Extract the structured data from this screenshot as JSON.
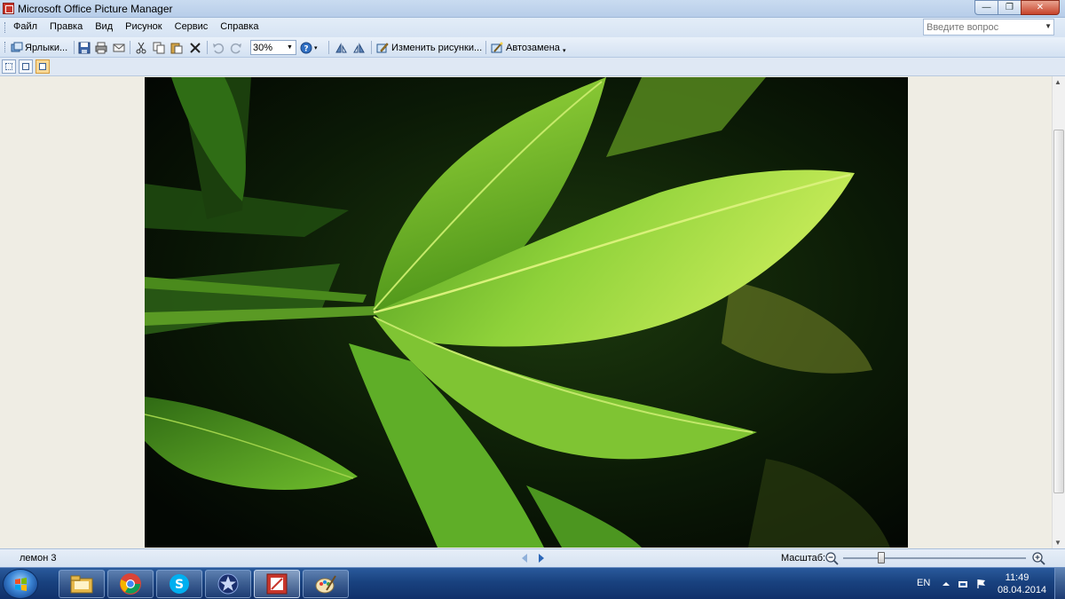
{
  "window": {
    "title": "Microsoft Office Picture Manager",
    "minimize": "—",
    "maximize": "❐",
    "close": "✕"
  },
  "menu": {
    "items": [
      "Файл",
      "Правка",
      "Вид",
      "Рисунок",
      "Сервис",
      "Справка"
    ],
    "ask_placeholder": "Введите вопрос"
  },
  "toolbar": {
    "shortcuts_label": "Ярлыки...",
    "zoom_value": "30%",
    "edit_pictures_label": "Изменить рисунки...",
    "autocorrect_label": "Автозамена"
  },
  "status": {
    "file_name": "лемон 3",
    "zoom_label": "Масштаб:",
    "zoom_slider_level": 0.21
  },
  "taskbar": {
    "language": "EN",
    "time": "11:49",
    "date": "08.04.2014"
  },
  "icons": {
    "window": "picture-manager-icon",
    "start": "windows-start-icon",
    "apps": [
      "file-explorer-icon",
      "chrome-icon",
      "skype-icon",
      "star-app-icon",
      "picture-manager-icon",
      "paint-icon"
    ]
  },
  "colors": {
    "accent": "#3a83d3",
    "close": "#c7432b",
    "leaf": "#8fd23a"
  }
}
